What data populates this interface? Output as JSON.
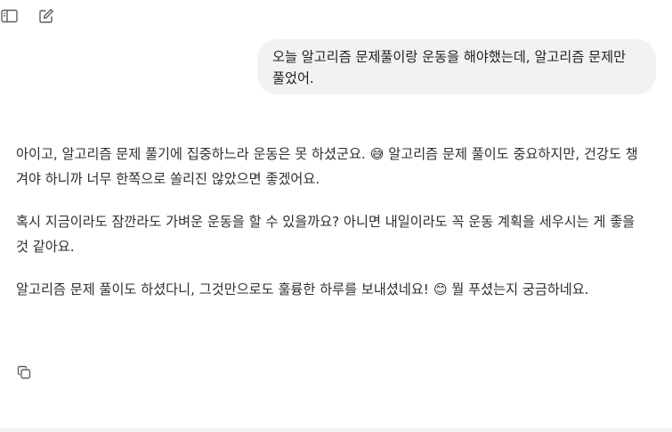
{
  "toolbar": {
    "sidebar_icon": "sidebar-toggle-icon",
    "compose_icon": "new-chat-icon"
  },
  "conversation": {
    "user_message": "오늘 알고리즘 문제풀이랑 운동을 해야했는데, 알고리즘 문제만 풀었어.",
    "assistant_paragraphs": [
      "아이고, 알고리즘 문제 풀기에 집중하느라 운동은 못 하셨군요. 😅 알고리즘 문제 풀이도 중요하지만, 건강도 챙겨야 하니까 너무 한쪽으로 쏠리진 않았으면 좋겠어요.",
      "혹시 지금이라도 잠깐라도 가벼운 운동을 할 수 있을까요? 아니면 내일이라도 꼭 운동 계획을 세우시는 게 좋을 것 같아요.",
      "알고리즘 문제 풀이도 하셨다니, 그것만으로도 훌륭한 하루를 보내셨네요! 😊 뭘 푸셨는지 궁금하네요."
    ],
    "copy_icon": "copy-icon"
  },
  "colors": {
    "user_bubble_bg": "#f2f2f2",
    "text": "#2e2e2e",
    "icon": "#5d5d5d"
  }
}
